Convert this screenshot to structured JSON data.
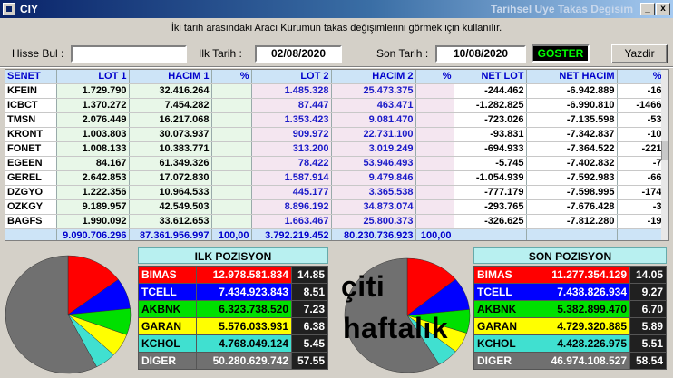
{
  "window": {
    "title": "CIY",
    "subtitle": "Tarihsel Uye Takas Degisim",
    "minimize": "_",
    "close": "x"
  },
  "info_text": "İki tarih arasındaki  Aracı Kurumun takas değişimlerini görmek için kullanılır.",
  "form": {
    "hisse_label": "Hisse Bul :",
    "hisse_value": "",
    "ilk_label": "Ilk Tarih :",
    "ilk_value": "02/08/2020",
    "son_label": "Son Tarih :",
    "son_value": "10/08/2020",
    "goster": "GOSTER",
    "yazdir": "Yazdir"
  },
  "grid": {
    "headers": [
      "SENET",
      "LOT 1",
      "HACIM 1",
      "%",
      "LOT 2",
      "HACIM 2",
      "%",
      "NET LOT",
      "NET HACIM",
      "%"
    ],
    "rows": [
      [
        "KFEIN",
        "1.729.790",
        "32.416.264",
        "",
        "1.485.328",
        "25.473.375",
        "",
        "-244.462",
        "-6.942.889",
        "-16"
      ],
      [
        "ICBCT",
        "1.370.272",
        "7.454.282",
        "",
        "87.447",
        "463.471",
        "",
        "-1.282.825",
        "-6.990.810",
        "-1466"
      ],
      [
        "TMSN",
        "2.076.449",
        "16.217.068",
        "",
        "1.353.423",
        "9.081.470",
        "",
        "-723.026",
        "-7.135.598",
        "-53"
      ],
      [
        "KRONT",
        "1.003.803",
        "30.073.937",
        "",
        "909.972",
        "22.731.100",
        "",
        "-93.831",
        "-7.342.837",
        "-10"
      ],
      [
        "FONET",
        "1.008.133",
        "10.383.771",
        "",
        "313.200",
        "3.019.249",
        "",
        "-694.933",
        "-7.364.522",
        "-221"
      ],
      [
        "EGEEN",
        "84.167",
        "61.349.326",
        "",
        "78.422",
        "53.946.493",
        "",
        "-5.745",
        "-7.402.832",
        "-7"
      ],
      [
        "GEREL",
        "2.642.853",
        "17.072.830",
        "",
        "1.587.914",
        "9.479.846",
        "",
        "-1.054.939",
        "-7.592.983",
        "-66"
      ],
      [
        "DZGYO",
        "1.222.356",
        "10.964.533",
        "",
        "445.177",
        "3.365.538",
        "",
        "-777.179",
        "-7.598.995",
        "-174"
      ],
      [
        "OZKGY",
        "9.189.957",
        "42.549.503",
        "",
        "8.896.192",
        "34.873.074",
        "",
        "-293.765",
        "-7.676.428",
        "-3"
      ],
      [
        "BAGFS",
        "1.990.092",
        "33.612.653",
        "",
        "1.663.467",
        "25.800.373",
        "",
        "-326.625",
        "-7.812.280",
        "-19"
      ]
    ],
    "totals": [
      "",
      "9.090.706.296",
      "87.361.956.997",
      "100,00",
      "3.792.219.452",
      "80.230.736.923",
      "100,00",
      "",
      "",
      ""
    ]
  },
  "ilk_pozisyon": {
    "title": "ILK POZISYON",
    "rows": [
      {
        "name": "BIMAS",
        "value": "12.978.581.834",
        "pct": "14.85",
        "color": "#ff0000",
        "share": 14.85
      },
      {
        "name": "TCELL",
        "value": "7.434.923.843",
        "pct": "8.51",
        "color": "#0000ff",
        "share": 8.51
      },
      {
        "name": "AKBNK",
        "value": "6.323.738.520",
        "pct": "7.23",
        "color": "#00e000",
        "share": 7.23
      },
      {
        "name": "GARAN",
        "value": "5.576.033.931",
        "pct": "6.38",
        "color": "#ffff00",
        "share": 6.38
      },
      {
        "name": "KCHOL",
        "value": "4.768.049.124",
        "pct": "5.45",
        "color": "#40e0d0",
        "share": 5.45
      },
      {
        "name": "DIGER",
        "value": "50.280.629.742",
        "pct": "57.55",
        "color": "#707070",
        "share": 57.55
      }
    ]
  },
  "son_pozisyon": {
    "title": "SON POZISYON",
    "rows": [
      {
        "name": "BIMAS",
        "value": "11.277.354.129",
        "pct": "14.05",
        "color": "#ff0000",
        "share": 14.05
      },
      {
        "name": "TCELL",
        "value": "7.438.826.934",
        "pct": "9.27",
        "color": "#0000ff",
        "share": 9.27
      },
      {
        "name": "AKBNK",
        "value": "5.382.899.470",
        "pct": "6.70",
        "color": "#00e000",
        "share": 6.7
      },
      {
        "name": "GARAN",
        "value": "4.729.320.885",
        "pct": "5.89",
        "color": "#ffff00",
        "share": 5.89
      },
      {
        "name": "KCHOL",
        "value": "4.428.226.975",
        "pct": "5.51",
        "color": "#40e0d0",
        "share": 5.51
      },
      {
        "name": "DIGER",
        "value": "46.974.108.527",
        "pct": "58.54",
        "color": "#707070",
        "share": 58.54
      }
    ]
  },
  "watermark": {
    "line1": "çiti",
    "line2": "haftalık"
  }
}
